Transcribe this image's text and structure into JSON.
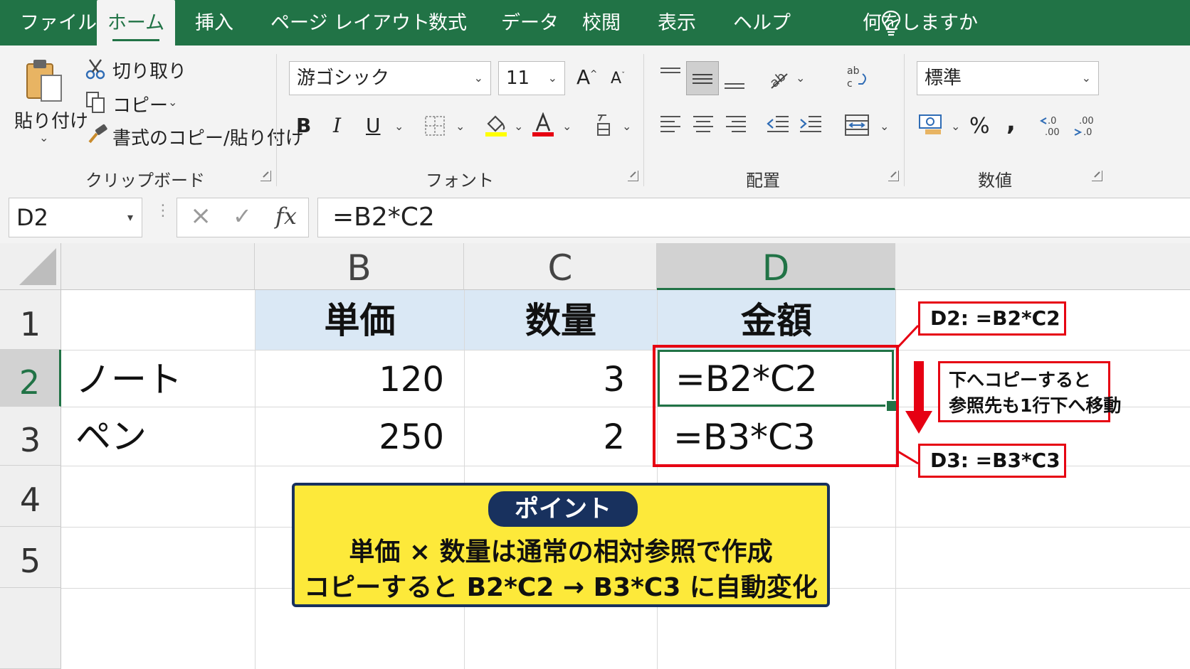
{
  "tabs": [
    "ファイル",
    "ホーム",
    "挿入",
    "ページ レイアウト",
    "数式",
    "データ",
    "校閲",
    "表示",
    "ヘルプ"
  ],
  "active_tab": "ホーム",
  "tell_me": "何をしますか",
  "ribbon": {
    "clipboard": {
      "paste_label": "貼り付け",
      "cut_label": "切り取り",
      "copy_label": "コピー",
      "format_painter_label": "書式のコピー/貼り付け",
      "group_label": "クリップボード"
    },
    "font": {
      "font_name": "游ゴシック",
      "font_size": "11",
      "bold": "B",
      "italic": "I",
      "underline": "U",
      "group_label": "フォント",
      "highlight_color": "#ffff00",
      "font_color": "#e60012"
    },
    "alignment": {
      "group_label": "配置"
    },
    "number": {
      "format": "標準",
      "percent": "%",
      "comma": ",",
      "group_label": "数値"
    }
  },
  "formula_bar": {
    "name_box": "D2",
    "fx": "fx",
    "formula": "=B2*C2"
  },
  "sheet": {
    "columns": [
      "B",
      "C",
      "D"
    ],
    "selected_column": "D",
    "rows": [
      "1",
      "2",
      "3",
      "4",
      "5"
    ],
    "selected_row": "2",
    "header_row": [
      "単価",
      "数量",
      "金額"
    ],
    "data_rows": [
      {
        "a": "ノート",
        "b": "120",
        "c": "3",
        "d": "=B2*C2"
      },
      {
        "a": "ペン",
        "b": "250",
        "c": "2",
        "d": "=B3*C3"
      }
    ],
    "header_fill": "#dae8f5",
    "selection_color": "#217346"
  },
  "annotations": {
    "callout_d2": "D2: =B2*C2",
    "callout_copy_line1": "下へコピーすると",
    "callout_copy_line2": "参照先も1行下へ移動",
    "callout_d3": "D3: =B3*C3",
    "highlight_color": "#e60012"
  },
  "point_box": {
    "tag": "ポイント",
    "line1": "単価 × 数量は通常の相対参照で作成",
    "line2": "コピーすると B2*C2 → B3*C3 に自動変化",
    "fill": "#fde93a",
    "border": "#18315e"
  }
}
